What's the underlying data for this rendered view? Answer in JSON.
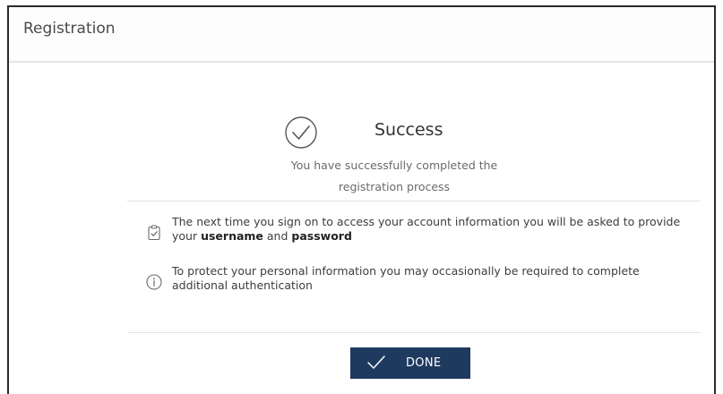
{
  "header": {
    "title": "Registration"
  },
  "success": {
    "icon": "check-circle-icon",
    "title": "Success",
    "description_line1": "You have successfully completed the",
    "description_line2": "registration process"
  },
  "notes": [
    {
      "icon": "clipboard-check-icon",
      "text_before": "The next time you sign on to access your account information you will be asked to provide your ",
      "bold1": "username",
      "middle": " and ",
      "bold2": "password"
    },
    {
      "icon": "info-icon",
      "text": "To protect your personal information you may occasionally be required to complete additional authentication"
    }
  ],
  "done_button": {
    "icon": "check-icon",
    "label": "DONE"
  },
  "colors": {
    "button_bg": "#1f3a5f",
    "button_text": "#ffffff",
    "frame_border": "#2a2a2a"
  }
}
